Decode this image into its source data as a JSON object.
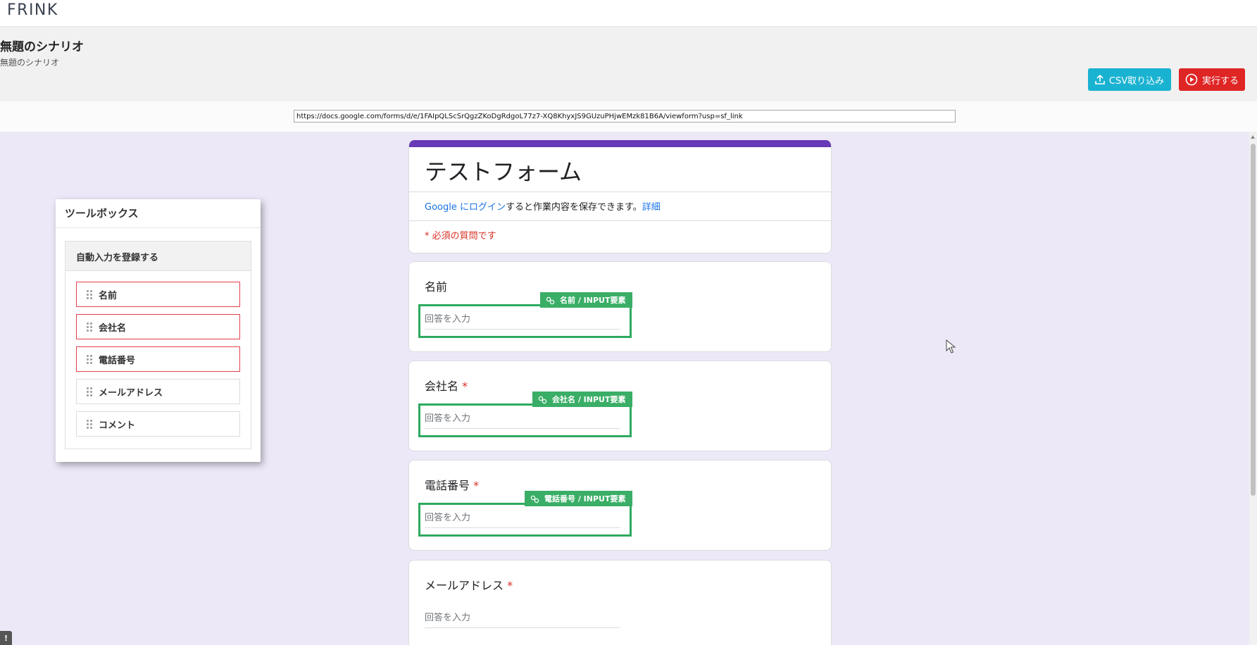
{
  "app": {
    "logo_text": "FRINK"
  },
  "scenario": {
    "title": "無題のシナリオ",
    "subtitle": "無題のシナリオ"
  },
  "actions": {
    "csv_label": "CSV取り込み",
    "run_label": "実行する"
  },
  "url_field": {
    "value": "https://docs.google.com/forms/d/e/1FAIpQLScSrQgzZKoDgRdgoL77z7-XQ8KhyxJS9GUzuPHjwEMzk81B6A/viewform?usp=sf_link"
  },
  "toolbox": {
    "title": "ツールボックス",
    "section_title": "自動入力を登録する",
    "items": [
      {
        "label": "名前",
        "required": true
      },
      {
        "label": "会社名",
        "required": true
      },
      {
        "label": "電話番号",
        "required": true
      },
      {
        "label": "メールアドレス",
        "required": false
      },
      {
        "label": "コメント",
        "required": false
      }
    ]
  },
  "form": {
    "title": "テストフォーム",
    "login_link": "Google にログイン",
    "login_text": "すると作業内容を保存できます。",
    "details_link": "詳細",
    "required_note": "* 必須の質問です",
    "questions": [
      {
        "label": "名前",
        "star": "",
        "placeholder": "回答を入力",
        "tag": "名前 / INPUT要素"
      },
      {
        "label": "会社名",
        "star": "*",
        "placeholder": "回答を入力",
        "tag": "会社名 / INPUT要素"
      },
      {
        "label": "電話番号",
        "star": "*",
        "placeholder": "回答を入力",
        "tag": "電話番号 / INPUT要素"
      },
      {
        "label": "メールアドレス",
        "star": "*",
        "placeholder": "回答を入力"
      }
    ]
  },
  "misc": {
    "corner_badge": "!"
  },
  "colors": {
    "accent_purple": "#673ab7",
    "csv_button": "#1ab2d1",
    "run_button": "#e02525",
    "highlight_green": "#2eaa5f",
    "required_red": "#d93025"
  }
}
